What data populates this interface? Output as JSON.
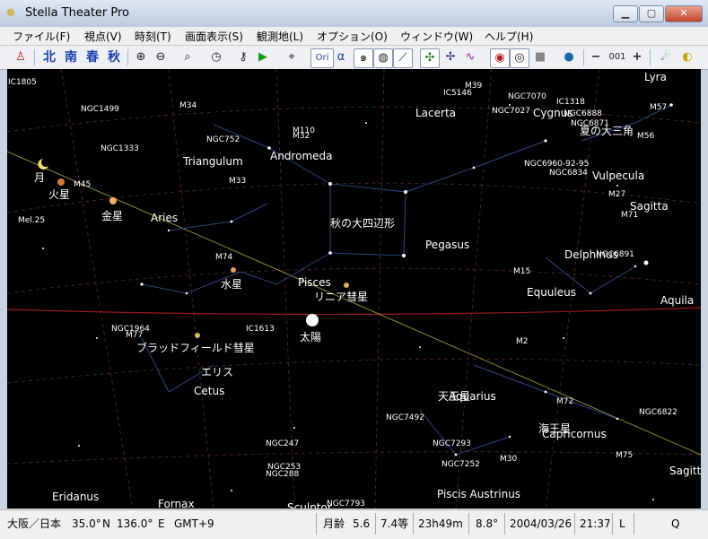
{
  "window": {
    "title": "Stella Theater Pro",
    "minimize": "0",
    "maximize": "1",
    "close": "r"
  },
  "menu": [
    "ファイル(F)",
    "視点(V)",
    "時刻(T)",
    "画面表示(S)",
    "観測地(L)",
    "オプション(O)",
    "ウィンドウ(W)",
    "ヘルプ(H)"
  ],
  "toolbar": {
    "seasons": [
      "北",
      "南",
      "春",
      "秋"
    ],
    "ori": "Ori",
    "alpha": "α",
    "zoom_value": "001",
    "minus": "−",
    "plus": "+"
  },
  "sky": {
    "constellations": [
      "Lyra",
      "Lacerta",
      "Cygnus",
      "夏の大三角",
      "Andromeda",
      "Triangulum",
      "Vulpecula",
      "Sagitta",
      "秋の大四辺形",
      "Pegasus",
      "Aries",
      "Delphinus",
      "Equuleus",
      "Pisces",
      "Aquila",
      "Aquarius",
      "Cetus",
      "Capricornus",
      "Eridanus",
      "Fornax",
      "Piscis Austrinus",
      "Sculptor",
      "Sagitt"
    ],
    "objects": [
      "IC1805",
      "M39",
      "NGC7070",
      "IC1318",
      "NGC1499",
      "IC5146",
      "NGC7027",
      "NGC6888",
      "M57",
      "M34",
      "NGC6871",
      "NGC752",
      "M110",
      "M56",
      "NGC1333",
      "M32",
      "NGC6960-92-95",
      "M45",
      "NGC6834",
      "M33",
      "M27",
      "Mel.25",
      "M71",
      "NGC6891",
      "M74",
      "M15",
      "NGC1964",
      "M77",
      "IC1613",
      "M2",
      "M72",
      "NGC6822",
      "NGC7492",
      "NGC7293",
      "NGC247",
      "M75",
      "NGC253",
      "NGC7252",
      "NGC288",
      "M30",
      "NGC7793"
    ],
    "planets": [
      "月",
      "火星",
      "金星",
      "水星",
      "太陽"
    ],
    "comets": [
      "リニア彗星",
      "ブラッドフィールド彗星"
    ],
    "asteroids": [
      "エリス",
      "海王星",
      "天王星"
    ]
  },
  "status": {
    "location": "大阪／日本",
    "lat": "35.0°",
    "lat_dir": "N",
    "lon": "136.0°",
    "lon_dir": "E",
    "tz": "GMT+9",
    "moon_age_label": "月齢",
    "moon_age": "5.6",
    "magnitude": "7.4等",
    "ra": "23h49m",
    "fov": "8.8°",
    "date": "2004/03/26",
    "time": "21:37",
    "L": "L",
    "Q": "Q"
  }
}
